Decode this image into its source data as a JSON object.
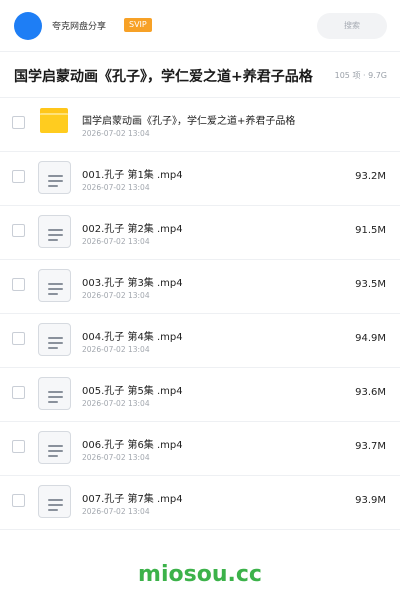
{
  "header": {
    "share_name": "夸克网盘分享",
    "badge": "SVIP",
    "search_placeholder": "搜索"
  },
  "folder": {
    "title": "国学启蒙动画《孔子》，学仁爱之道+养君子品格",
    "meta": "105 项 · 9.7G"
  },
  "items": [
    {
      "type": "folder",
      "name": "国学启蒙动画《孔子》，学仁爱之道+养君子品格",
      "date": "2026-07-02 13:04",
      "size": ""
    },
    {
      "type": "file",
      "name": "001.孔子 第1集 .mp4",
      "date": "2026-07-02 13:04",
      "size": "93.2M"
    },
    {
      "type": "file",
      "name": "002.孔子 第2集 .mp4",
      "date": "2026-07-02 13:04",
      "size": "91.5M"
    },
    {
      "type": "file",
      "name": "003.孔子 第3集 .mp4",
      "date": "2026-07-02 13:04",
      "size": "93.5M"
    },
    {
      "type": "file",
      "name": "004.孔子 第4集 .mp4",
      "date": "2026-07-02 13:04",
      "size": "94.9M"
    },
    {
      "type": "file",
      "name": "005.孔子 第5集 .mp4",
      "date": "2026-07-02 13:04",
      "size": "93.6M"
    },
    {
      "type": "file",
      "name": "006.孔子 第6集 .mp4",
      "date": "2026-07-02 13:04",
      "size": "93.7M"
    },
    {
      "type": "file",
      "name": "007.孔子 第7集 .mp4",
      "date": "2026-07-02 13:04",
      "size": "93.9M"
    }
  ],
  "watermark": "miosou.cc",
  "colors": {
    "accent": "#1e7ef5",
    "badge": "#f7a126",
    "folder": "#ffcc1f",
    "watermark": "#3cb24a"
  }
}
